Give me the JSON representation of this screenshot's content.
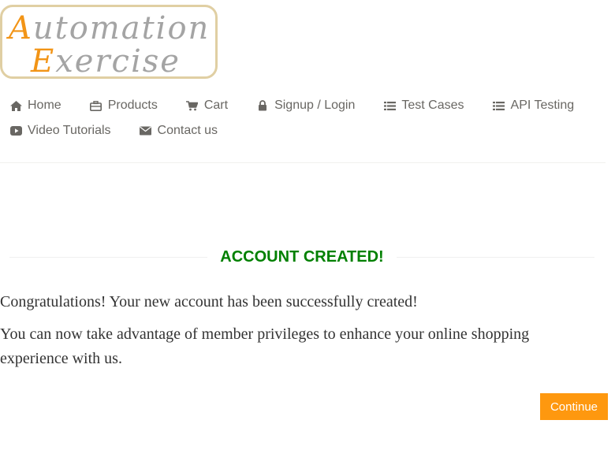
{
  "logo": {
    "line1_cap": "A",
    "line1_rest": "utomation",
    "line2_cap": "E",
    "line2_rest": "xercise"
  },
  "nav": {
    "items": [
      {
        "label": "Home",
        "icon": "home-icon"
      },
      {
        "label": "Products",
        "icon": "briefcase-icon"
      },
      {
        "label": "Cart",
        "icon": "cart-icon"
      },
      {
        "label": "Signup / Login",
        "icon": "lock-icon"
      },
      {
        "label": "Test Cases",
        "icon": "list-icon"
      },
      {
        "label": "API Testing",
        "icon": "list-icon"
      },
      {
        "label": "Video Tutorials",
        "icon": "youtube-play-icon"
      },
      {
        "label": "Contact us",
        "icon": "envelope-icon"
      }
    ]
  },
  "main": {
    "title": "ACCOUNT CREATED!",
    "message1": "Congratulations! Your new account has been successfully created!",
    "message2": "You can now take advantage of member privileges to enhance your online shopping experience with us.",
    "continue_label": "Continue"
  },
  "colors": {
    "accent": "#fe980f",
    "title_green": "#008000",
    "nav_text": "#696763"
  }
}
